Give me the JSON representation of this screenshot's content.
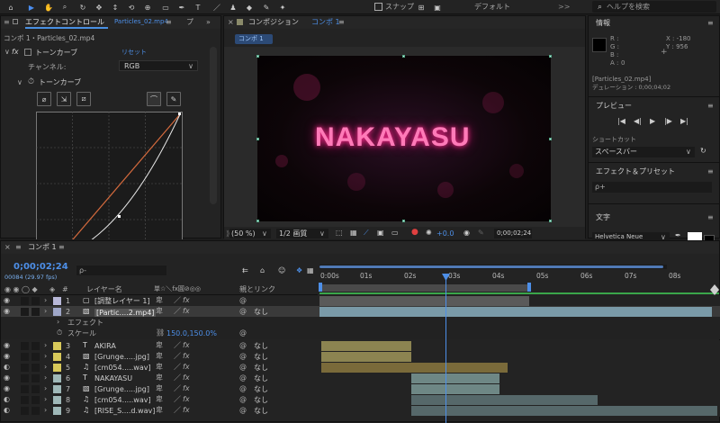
{
  "topbar": {
    "snap": "スナップ",
    "workspace": "デフォルト",
    "search_placeholder": "ヘルプを検索",
    "menu_icon": ">>"
  },
  "effect_controls": {
    "tab_title": "エフェクトコントロール",
    "tab_file": "Particles_02.mp4",
    "tab_more": "プ",
    "breadcrumb": "コンポ 1・Particles_02.mp4",
    "fx": "fx",
    "effect_name": "トーンカーブ",
    "reset": "リセット",
    "channel_label": "チャンネル:",
    "channel_value": "RGB",
    "curve_label": "トーンカーブ"
  },
  "composition": {
    "tab_title": "コンポジション",
    "tab_comp": "コンポ 1",
    "comp_button": "コンポ 1",
    "title_text": "NAKAYASU",
    "zoom": "(50 %)",
    "quality": "1/2 画質",
    "exposure": "+0.0",
    "timecode": "0;00;02;24"
  },
  "info": {
    "title": "情報",
    "r": "R :",
    "g": "G :",
    "b": "B :",
    "a": "A :",
    "a_val": "0",
    "x": "X : -180",
    "y": "Y : 956",
    "file": "[Particles_02.mp4]",
    "duration": "デュレーション : 0;00;04;02"
  },
  "preview": {
    "title": "プレビュー",
    "shortcut_label": "ショートカット",
    "shortcut_value": "スペースバー"
  },
  "effects_presets": {
    "title": "エフェクト＆プリセット",
    "search_icon": "ρ+"
  },
  "character": {
    "title": "文字",
    "font": "Helvetica Neue"
  },
  "timeline": {
    "tab": "コンポ 1",
    "timecode": "0;00;02;24",
    "frame": "00084 (29.97 fps)",
    "search": "ρ-",
    "col_name": "レイヤー名",
    "col_switch": "単☆＼fx圓⊘◎◎",
    "col_parent": "親とリンク",
    "ruler": [
      "0:00s",
      "01s",
      "02s",
      "03s",
      "04s",
      "05s",
      "06s",
      "07s",
      "08s"
    ],
    "effect_group": "エフェクト",
    "scale_label": "スケール",
    "scale_value": "150.0,150.0%",
    "layers": [
      {
        "num": "1",
        "name": "[調整レイヤー 1]",
        "parent": "",
        "color": "#b8b8d8"
      },
      {
        "num": "2",
        "name": "[Partic....2.mp4]",
        "parent": "なし",
        "color": "#9fa7c8"
      },
      {
        "num": "3",
        "name": "AKIRA",
        "parent": "なし",
        "color": "#d8c95a"
      },
      {
        "num": "4",
        "name": "[Grunge.....jpg]",
        "parent": "なし",
        "color": "#d8c95a"
      },
      {
        "num": "5",
        "name": "[cm054.....wav]",
        "parent": "なし",
        "color": "#d8c95a"
      },
      {
        "num": "6",
        "name": "NAKAYASU",
        "parent": "なし",
        "color": "#9fb8b8"
      },
      {
        "num": "7",
        "name": "[Grunge.....jpg]",
        "parent": "なし",
        "color": "#9fb8b8"
      },
      {
        "num": "8",
        "name": "[cm054.....wav]",
        "parent": "なし",
        "color": "#9fb8b8"
      },
      {
        "num": "9",
        "name": "[RISE_S....d.wav]",
        "parent": "なし",
        "color": "#9fb8b8"
      }
    ]
  }
}
